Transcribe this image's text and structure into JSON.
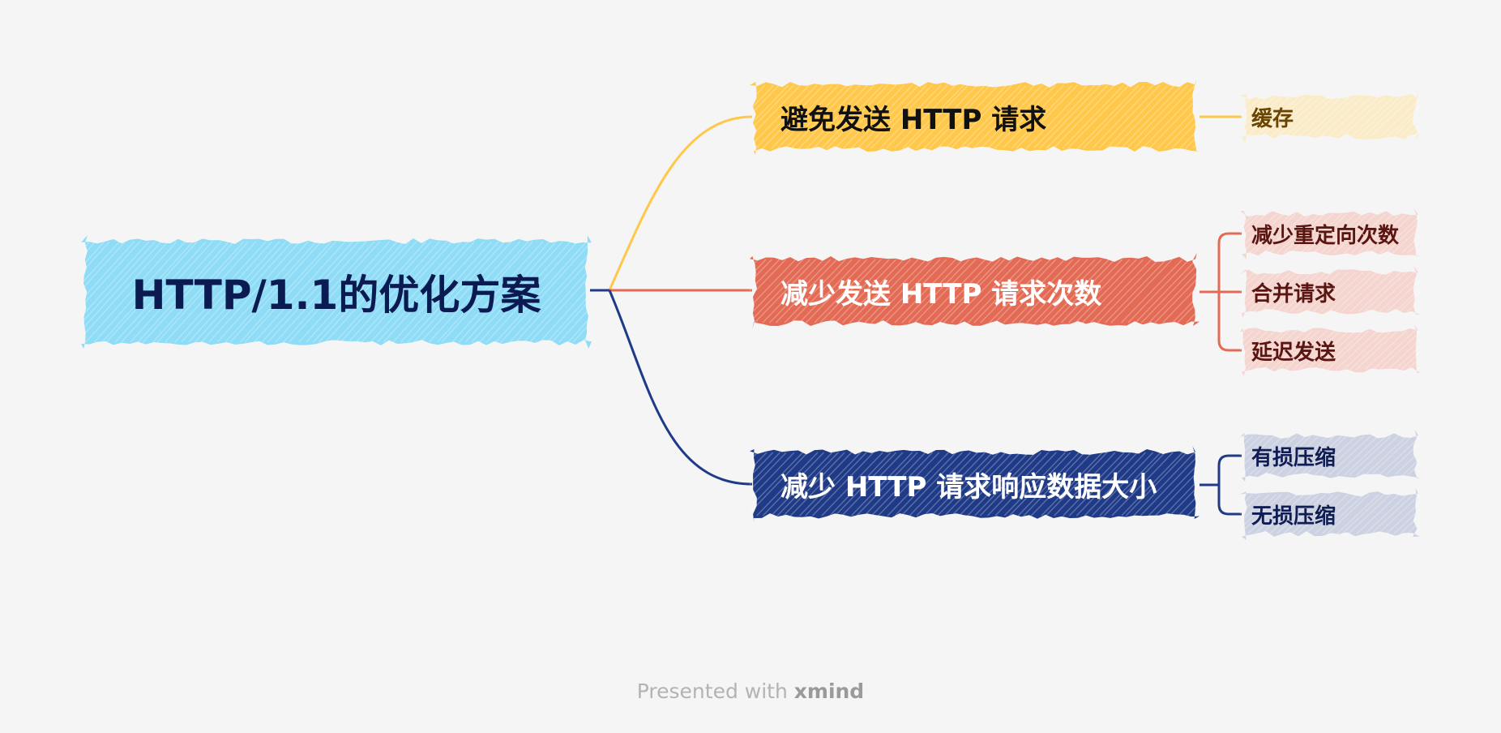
{
  "root": {
    "label": "HTTP/1.1的优化方案",
    "fill": "#8fdcf6"
  },
  "branches": [
    {
      "label": "避免发送 HTTP 请求",
      "fill": "#ffc84a",
      "line": "#ffc84a",
      "children": [
        {
          "label": "缓存",
          "fill": "#fbecc9"
        }
      ]
    },
    {
      "label": "减少发送 HTTP 请求次数",
      "fill": "#e36b55",
      "line": "#e36b55",
      "children": [
        {
          "label": "减少重定向次数",
          "fill": "#f5d5d0"
        },
        {
          "label": "合并请求",
          "fill": "#f5d5d0"
        },
        {
          "label": "延迟发送",
          "fill": "#f5d5d0"
        }
      ]
    },
    {
      "label": "减少 HTTP 请求响应数据大小",
      "fill": "#1f3a86",
      "line": "#1f3a86",
      "children": [
        {
          "label": "有损压缩",
          "fill": "#cdd2e2"
        },
        {
          "label": "无损压缩",
          "fill": "#cdd2e2"
        }
      ]
    }
  ],
  "footer": {
    "prefix": "Presented with",
    "brand": "xmind"
  }
}
